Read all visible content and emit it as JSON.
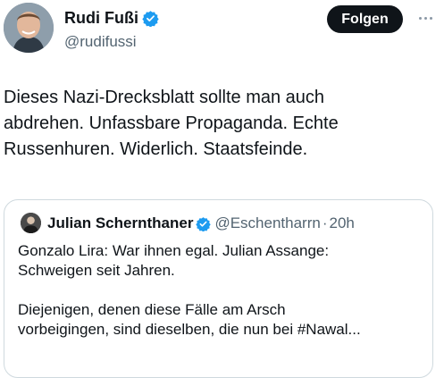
{
  "tweet": {
    "author_name": "Rudi Fußi",
    "author_handle": "@rudifussi",
    "follow_label": "Folgen",
    "text": "Dieses Nazi-Drecksblatt sollte man auch\nabdrehen. Unfassbare Propaganda. Echte\nRussenhuren. Widerlich. Staatsfeinde.",
    "verified_color": "#1d9bf0"
  },
  "quoted_tweet": {
    "author_name": "Julian Schernthaner",
    "author_handle": "@Eschentharrn",
    "separator": "·",
    "time": "20h",
    "text": "Gonzalo Lira: War ihnen egal. Julian Assange:\nSchweigen seit Jahren.\n\nDiejenigen, denen diese Fälle am Arsch\nvorbeigingen, sind dieselben, die nun bei #Nawal..."
  }
}
